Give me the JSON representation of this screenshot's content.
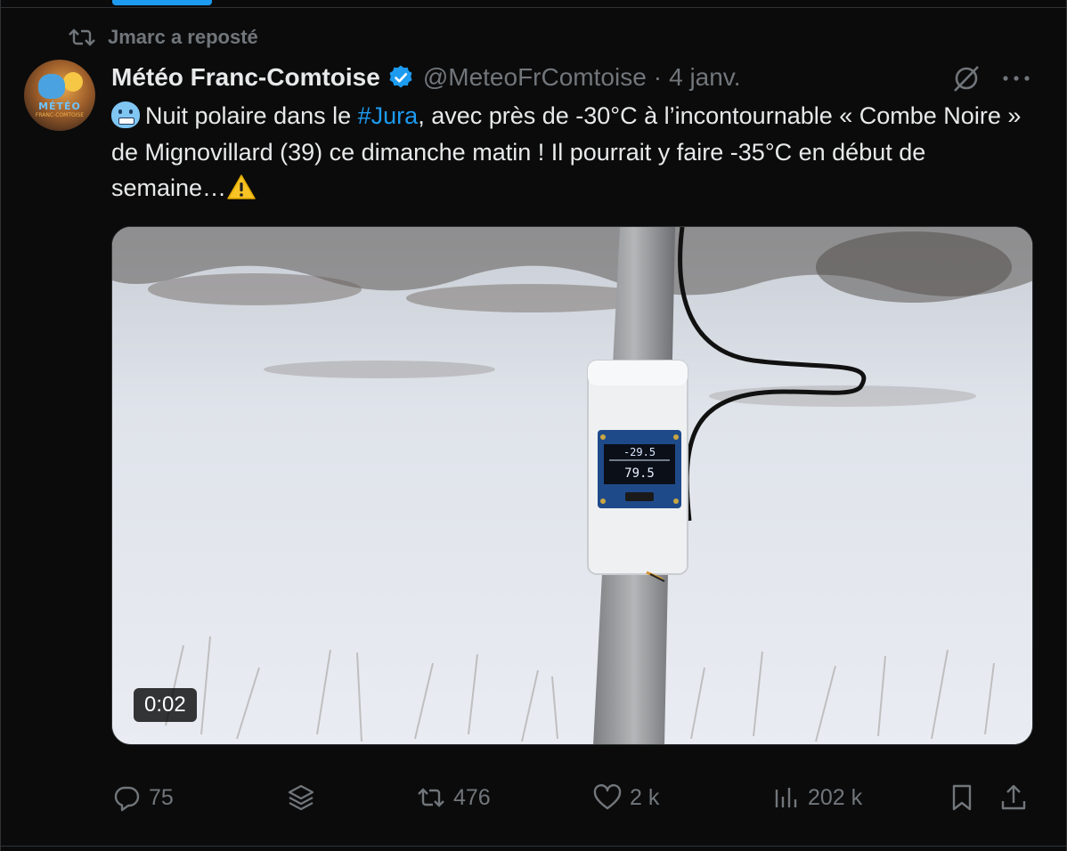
{
  "repost": {
    "label": "Jmarc a reposté",
    "icon": "repost-icon"
  },
  "author": {
    "display_name": "Météo Franc-Comtoise",
    "handle": "@MeteoFrComtoise",
    "separator": "·",
    "date": "4 janv.",
    "verified": true,
    "avatar_text": "MÉTÉO",
    "avatar_subtext": "FRANC-COMTOISE"
  },
  "tweet": {
    "text_before_hashtag": "Nuit polaire dans le ",
    "hashtag": "#Jura",
    "text_after_hashtag": ", avec près de -30°C à l’incontournable « Combe Noire » de Mignovillard (39) ce dimanche matin ! Il pourrait y faire -35°C en début de semaine…",
    "leading_emoji": "cold-face-emoji",
    "trailing_emoji": "warning-emoji"
  },
  "media": {
    "type": "video",
    "duration": "0:02",
    "sensor_display_line1": "79.5",
    "sensor_display_top": "-29.5"
  },
  "actions": {
    "replies": "75",
    "reposts": "476",
    "likes": "2 k",
    "views": "202 k"
  },
  "colors": {
    "background": "#000000",
    "text": "#e7e9ea",
    "muted": "#71767b",
    "accent": "#1d9bf0"
  }
}
